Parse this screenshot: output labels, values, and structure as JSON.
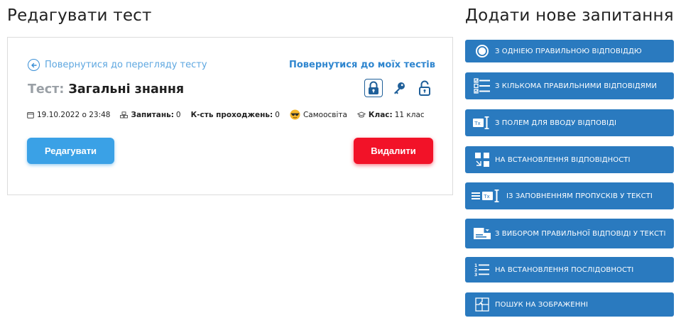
{
  "page": {
    "title": "Редагувати тест",
    "sidebar_title": "Додати нове запитання"
  },
  "card": {
    "back_link": "Повернутися до перегляду тесту",
    "my_tests_link": "Повернутися до моїх тестів",
    "test_label": "Тест:",
    "test_name": "Загальні знання",
    "meta": {
      "date": "19.10.2022 о 23:48",
      "questions_label": "Запитань:",
      "questions_value": "0",
      "passes_label": "К-сть проходжень:",
      "passes_value": "0",
      "mode": "Самоосвіта",
      "class_label": "Клас:",
      "class_value": "11 клас"
    },
    "edit_button": "Редагувати",
    "delete_button": "Видалити"
  },
  "question_types": [
    {
      "label": "З одніею правильною відповіддю",
      "icon": "radio-icon"
    },
    {
      "label": "З кількома правильними відповідями",
      "icon": "checklist-icon"
    },
    {
      "label": "З полем для вводу відповіді",
      "icon": "text-input-icon"
    },
    {
      "label": "На встановлення відповідності",
      "icon": "matching-icon"
    },
    {
      "label": "Із заповненням пропусків у тексті",
      "icon": "fill-gaps-icon"
    },
    {
      "label": "З вибором правильної відповіді у тексті",
      "icon": "dropdown-text-icon"
    },
    {
      "label": "На встановлення послідовності",
      "icon": "ordered-list-icon"
    },
    {
      "label": "Пошук на зображенні",
      "icon": "puzzle-icon"
    }
  ],
  "colors": {
    "accent_blue": "#2a7abf",
    "edit_button": "#3aa1e6",
    "delete_button": "#f21228",
    "link": "#2f86cf"
  }
}
